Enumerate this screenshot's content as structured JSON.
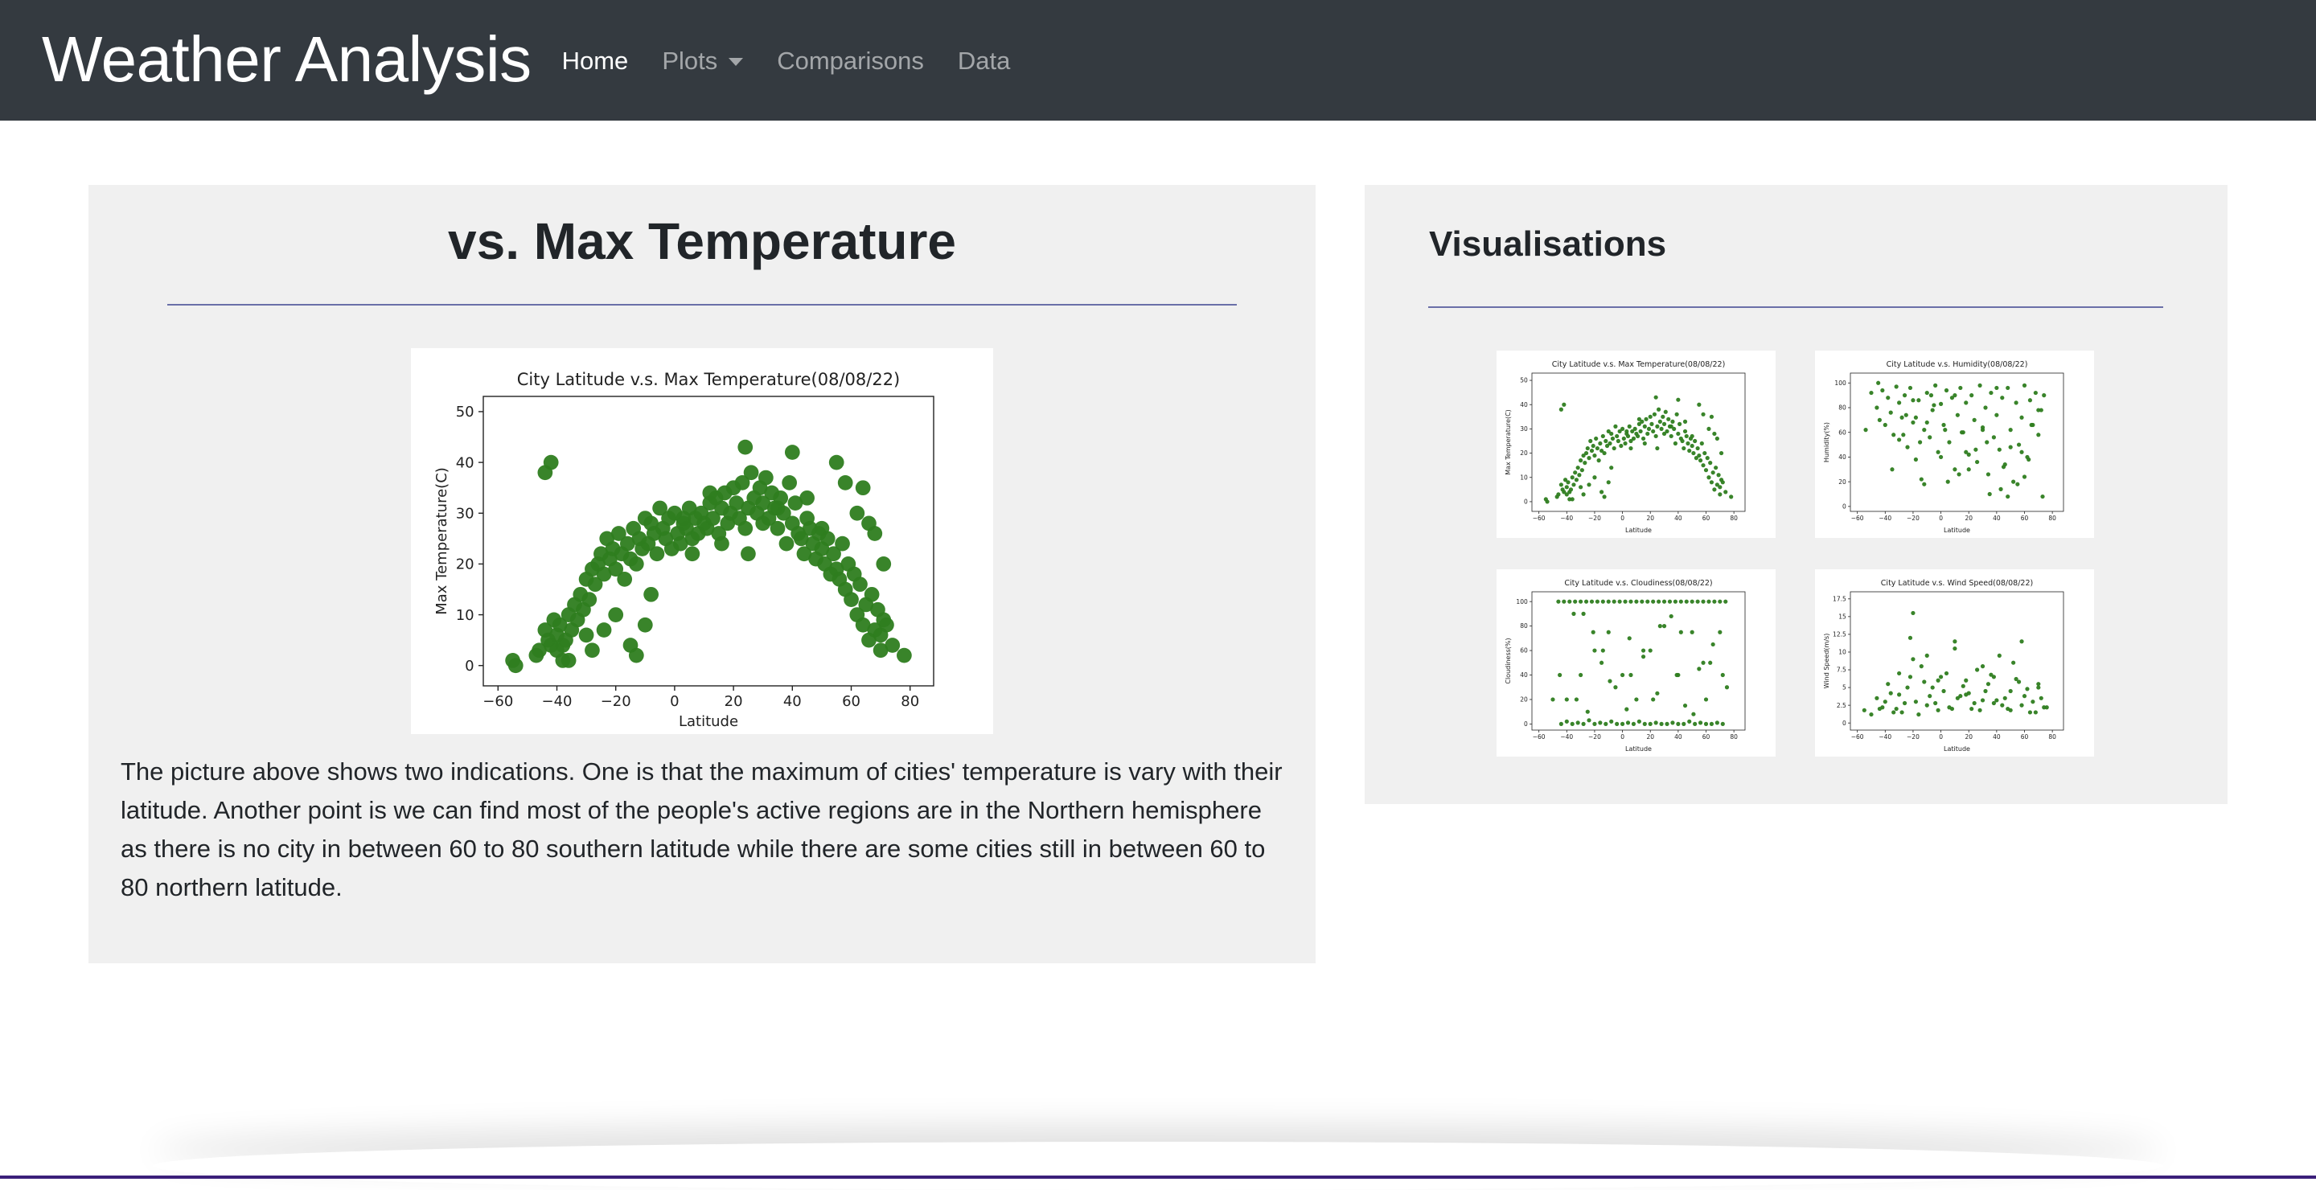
{
  "nav": {
    "brand": "Weather Analysis",
    "links": [
      {
        "label": "Home",
        "active": true
      },
      {
        "label": "Plots",
        "dropdown": true
      },
      {
        "label": "Comparisons"
      },
      {
        "label": "Data"
      }
    ]
  },
  "main": {
    "title": "vs. Max Temperature",
    "description": "The picture above shows two indications. One is that the maximum of cities' temperature is vary with their latitude. Another point is we can find most of the people's active regions are in the Northern hemisphere as there is no city in between 60 to 80 southern latitude while there are some cities still in between 60 to 80 northern latitude."
  },
  "sidebar": {
    "title": "Visualisations"
  },
  "colors": {
    "navbar": "#343a40",
    "panel": "#f0f0f0",
    "rule": "#6a6fa8",
    "marker": "#2e7d1f"
  },
  "chart_data": [
    {
      "id": "main-temp",
      "type": "scatter",
      "title": "City Latitude v.s. Max Temperature(08/08/22)",
      "xlabel": "Latitude",
      "ylabel": "Max Temperature(C)",
      "xlim": [
        -65,
        88
      ],
      "ylim": [
        -4,
        53
      ],
      "xticks": [
        -60,
        -40,
        -20,
        0,
        20,
        40,
        60,
        80
      ],
      "yticks": [
        0,
        10,
        20,
        30,
        40,
        50
      ],
      "x": [
        -55,
        -54,
        -47,
        -46,
        -44,
        -43,
        -42,
        -41,
        -40,
        -40,
        -39,
        -38,
        -38,
        -37,
        -36,
        -35,
        -34,
        -33,
        -32,
        -31,
        -30,
        -29,
        -28,
        -27,
        -26,
        -25,
        -24,
        -23,
        -22,
        -21,
        -20,
        -19,
        -18,
        -17,
        -16,
        -15,
        -14,
        -13,
        -12,
        -11,
        -10,
        -9,
        -8,
        -7,
        -6,
        -5,
        -4,
        -3,
        -2,
        -1,
        0,
        1,
        2,
        3,
        4,
        5,
        6,
        7,
        8,
        9,
        10,
        11,
        12,
        13,
        14,
        15,
        16,
        17,
        18,
        19,
        20,
        21,
        22,
        23,
        24,
        25,
        26,
        27,
        28,
        29,
        30,
        31,
        32,
        33,
        34,
        35,
        36,
        37,
        38,
        39,
        40,
        41,
        42,
        43,
        44,
        45,
        46,
        47,
        48,
        49,
        50,
        51,
        52,
        53,
        54,
        55,
        56,
        57,
        58,
        59,
        60,
        61,
        62,
        63,
        64,
        65,
        66,
        67,
        68,
        69,
        70,
        71,
        72,
        -15,
        -13,
        24,
        25,
        40,
        -44,
        -42,
        -30,
        -28,
        -20,
        -8,
        3,
        12,
        35,
        50,
        55,
        62,
        66,
        68,
        70,
        74,
        78,
        -36,
        -24,
        -10,
        6,
        16,
        30,
        45,
        58,
        64,
        71
      ],
      "y": [
        1,
        0,
        2,
        3,
        7,
        5,
        4,
        9,
        3,
        6,
        8,
        4,
        1,
        5,
        10,
        7,
        12,
        9,
        14,
        11,
        17,
        13,
        19,
        16,
        20,
        22,
        18,
        25,
        21,
        23,
        19,
        26,
        22,
        17,
        24,
        21,
        27,
        20,
        25,
        23,
        29,
        24,
        28,
        26,
        22,
        31,
        27,
        25,
        29,
        23,
        30,
        26,
        24,
        28,
        27,
        31,
        25,
        29,
        26,
        30,
        28,
        27,
        32,
        29,
        33,
        26,
        31,
        34,
        28,
        30,
        35,
        32,
        29,
        36,
        43,
        31,
        38,
        33,
        30,
        35,
        32,
        37,
        29,
        34,
        31,
        27,
        33,
        30,
        24,
        36,
        28,
        32,
        26,
        25,
        22,
        29,
        27,
        24,
        21,
        26,
        23,
        20,
        25,
        18,
        22,
        19,
        17,
        24,
        15,
        20,
        13,
        18,
        10,
        16,
        8,
        12,
        5,
        14,
        7,
        11,
        3,
        9,
        8,
        4,
        2,
        27,
        22,
        42,
        38,
        40,
        6,
        3,
        10,
        14,
        29,
        34,
        31,
        27,
        40,
        30,
        28,
        26,
        6,
        4,
        2,
        1,
        7,
        8,
        22,
        24,
        28,
        33,
        36,
        35,
        20,
        15,
        25
      ],
      "markerSize": 5.2
    },
    {
      "id": "thumb-temp",
      "type": "scatter",
      "title": "City Latitude v.s. Max Temperature(08/08/22)",
      "xlabel": "Latitude",
      "ylabel": "Max Temperature(C)",
      "xlim": [
        -65,
        88
      ],
      "ylim": [
        -4,
        53
      ],
      "xticks": [
        -60,
        -40,
        -20,
        0,
        20,
        40,
        60,
        80
      ],
      "yticks": [
        0,
        10,
        20,
        30,
        40,
        50
      ],
      "ref": "main-temp"
    },
    {
      "id": "thumb-humidity",
      "type": "scatter",
      "title": "City Latitude v.s. Humidity(08/08/22)",
      "xlabel": "Latitude",
      "ylabel": "Humidity(%)",
      "xlim": [
        -65,
        88
      ],
      "ylim": [
        -4,
        108
      ],
      "xticks": [
        -60,
        -40,
        -20,
        0,
        20,
        40,
        60,
        80
      ],
      "yticks": [
        0,
        20,
        40,
        60,
        80,
        100
      ],
      "x": [
        -54,
        -50,
        -46,
        -44,
        -42,
        -40,
        -38,
        -36,
        -34,
        -32,
        -30,
        -28,
        -26,
        -24,
        -22,
        -20,
        -18,
        -16,
        -14,
        -12,
        -10,
        -8,
        -6,
        -4,
        -2,
        0,
        2,
        4,
        6,
        8,
        10,
        12,
        14,
        16,
        18,
        20,
        22,
        24,
        26,
        28,
        30,
        32,
        34,
        36,
        38,
        40,
        42,
        44,
        46,
        48,
        50,
        52,
        54,
        56,
        58,
        60,
        62,
        64,
        66,
        68,
        70,
        72,
        74,
        -35,
        -25,
        -15,
        -5,
        5,
        15,
        25,
        35,
        45,
        55,
        65,
        -30,
        -20,
        -10,
        0,
        10,
        20,
        30,
        40,
        50,
        60,
        70,
        -45,
        -18,
        -12,
        3,
        18,
        33,
        48,
        63,
        -27,
        -7,
        13,
        43,
        58,
        73
      ],
      "y": [
        62,
        92,
        80,
        70,
        94,
        66,
        88,
        76,
        58,
        97,
        84,
        72,
        90,
        48,
        96,
        68,
        38,
        86,
        22,
        62,
        92,
        56,
        78,
        98,
        44,
        83,
        66,
        94,
        52,
        88,
        30,
        74,
        96,
        60,
        84,
        42,
        90,
        70,
        36,
        98,
        64,
        80,
        26,
        92,
        56,
        74,
        46,
        88,
        34,
        96,
        62,
        20,
        84,
        50,
        72,
        98,
        40,
        86,
        66,
        92,
        58,
        78,
        90,
        30,
        74,
        52,
        82,
        20,
        60,
        46,
        10,
        32,
        18,
        66,
        54,
        86,
        68,
        40,
        90,
        30,
        62,
        96,
        48,
        24,
        78,
        100,
        72,
        18,
        62,
        44,
        52,
        8,
        38,
        58,
        90,
        26,
        14,
        44,
        8
      ],
      "markerSize": 2.6
    },
    {
      "id": "thumb-cloudiness",
      "type": "scatter",
      "title": "City Latitude v.s. Cloudiness(08/08/22)",
      "xlabel": "Latitude",
      "ylabel": "Cloudiness(%)",
      "xlim": [
        -65,
        88
      ],
      "ylim": [
        -5,
        108
      ],
      "xticks": [
        -60,
        -40,
        -20,
        0,
        20,
        40,
        60,
        80
      ],
      "yticks": [
        0,
        20,
        40,
        60,
        80,
        100
      ],
      "x": [
        -46,
        -42,
        -38,
        -34,
        -30,
        -26,
        -22,
        -18,
        -14,
        -10,
        -6,
        -2,
        2,
        6,
        10,
        14,
        18,
        22,
        26,
        30,
        34,
        38,
        42,
        46,
        50,
        54,
        58,
        62,
        66,
        70,
        74,
        -44,
        -40,
        -36,
        -32,
        -28,
        -24,
        -20,
        -16,
        -12,
        -8,
        -4,
        0,
        4,
        8,
        12,
        16,
        20,
        24,
        28,
        32,
        36,
        40,
        44,
        48,
        52,
        56,
        60,
        64,
        68,
        72,
        -40,
        -30,
        -20,
        -10,
        0,
        10,
        20,
        30,
        40,
        50,
        60,
        70,
        -35,
        -25,
        -15,
        -5,
        5,
        15,
        25,
        35,
        45,
        55,
        65,
        -45,
        -33,
        -21,
        -9,
        3,
        15,
        27,
        39,
        51,
        63,
        75,
        -50,
        -28,
        -14,
        6,
        22,
        42,
        58,
        72
      ],
      "y": [
        100,
        100,
        100,
        100,
        100,
        100,
        100,
        100,
        100,
        100,
        100,
        100,
        100,
        100,
        100,
        100,
        100,
        100,
        100,
        100,
        100,
        100,
        100,
        100,
        100,
        100,
        100,
        100,
        100,
        100,
        100,
        0,
        2,
        0,
        1,
        0,
        3,
        0,
        1,
        0,
        2,
        0,
        0,
        1,
        0,
        2,
        0,
        0,
        1,
        0,
        0,
        1,
        0,
        0,
        2,
        0,
        1,
        0,
        0,
        1,
        0,
        20,
        40,
        60,
        75,
        40,
        20,
        60,
        80,
        40,
        75,
        20,
        75,
        90,
        10,
        50,
        30,
        70,
        55,
        25,
        88,
        15,
        45,
        65,
        40,
        20,
        75,
        35,
        12,
        60,
        80,
        40,
        8,
        50,
        30,
        20,
        90,
        60,
        40,
        20,
        75,
        50,
        40
      ],
      "markerSize": 2.6
    },
    {
      "id": "thumb-wind",
      "type": "scatter",
      "title": "City Latitude v.s. Wind Speed(08/08/22)",
      "xlabel": "Latitude",
      "ylabel": "Wind Speed(m/s)",
      "xlim": [
        -65,
        88
      ],
      "ylim": [
        -1,
        18.5
      ],
      "xticks": [
        -60,
        -40,
        -20,
        0,
        20,
        40,
        60,
        80
      ],
      "yticks": [
        0,
        2.5,
        5,
        7.5,
        10,
        12.5,
        15,
        17.5
      ],
      "x": [
        -55,
        -50,
        -46,
        -42,
        -38,
        -34,
        -30,
        -26,
        -22,
        -20,
        -18,
        -14,
        -10,
        -6,
        -2,
        2,
        6,
        10,
        14,
        18,
        22,
        26,
        30,
        34,
        38,
        42,
        46,
        50,
        54,
        58,
        62,
        66,
        70,
        74,
        -44,
        -36,
        -28,
        -20,
        -12,
        -4,
        4,
        12,
        20,
        28,
        36,
        44,
        52,
        60,
        68,
        76,
        -40,
        -32,
        -24,
        -16,
        -8,
        0,
        8,
        16,
        24,
        32,
        40,
        48,
        56,
        64,
        72,
        -30,
        -10,
        10,
        30,
        50,
        70,
        -22,
        -2,
        18,
        38,
        58
      ],
      "y": [
        1.8,
        1.2,
        3.5,
        2.2,
        5.5,
        1.5,
        4.0,
        2.8,
        6.5,
        15.5,
        3.0,
        8.0,
        2.5,
        5.0,
        1.8,
        4.5,
        2.2,
        11.5,
        3.8,
        6.0,
        2.0,
        7.5,
        3.2,
        5.5,
        2.8,
        9.5,
        3.5,
        1.8,
        6.2,
        2.5,
        4.8,
        3.0,
        5.5,
        2.2,
        2.0,
        4.2,
        1.5,
        9.0,
        5.8,
        2.8,
        7.0,
        3.5,
        4.2,
        1.8,
        6.8,
        2.5,
        8.5,
        3.8,
        1.5,
        2.2,
        3.0,
        2.0,
        5.0,
        1.2,
        3.8,
        6.5,
        2.0,
        5.2,
        2.8,
        4.5,
        3.2,
        2.0,
        5.8,
        1.5,
        3.5,
        7.0,
        9.5,
        10.5,
        8.0,
        4.5,
        5.0,
        12.0,
        6.0,
        4.0,
        6.5,
        11.5
      ],
      "markerSize": 2.6
    }
  ]
}
